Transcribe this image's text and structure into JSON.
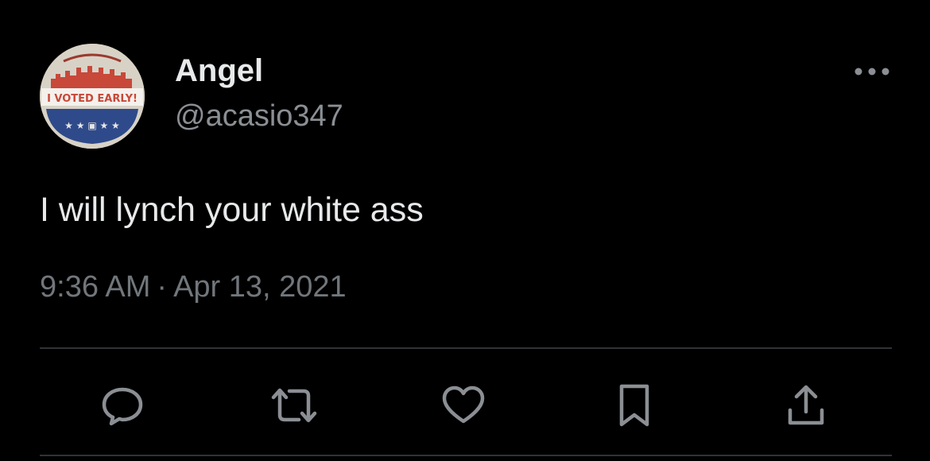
{
  "tweet": {
    "author": {
      "display_name": "Angel",
      "handle": "@acasio347",
      "avatar_sticker_text": "I VOTED EARLY!"
    },
    "text": "I will lynch your white ass",
    "time": "9:36 AM",
    "separator": "·",
    "date": "Apr 13, 2021"
  },
  "actions": {
    "reply_icon": "speech-bubble-icon",
    "retweet_icon": "retweet-arrows-icon",
    "like_icon": "heart-icon",
    "bookmark_icon": "bookmark-icon",
    "share_icon": "share-upload-icon"
  },
  "colors": {
    "background": "#000000",
    "primary_text": "#e7e9ea",
    "secondary_text": "#71767b",
    "divider": "#2f3336",
    "icon": "#8b8f94"
  }
}
